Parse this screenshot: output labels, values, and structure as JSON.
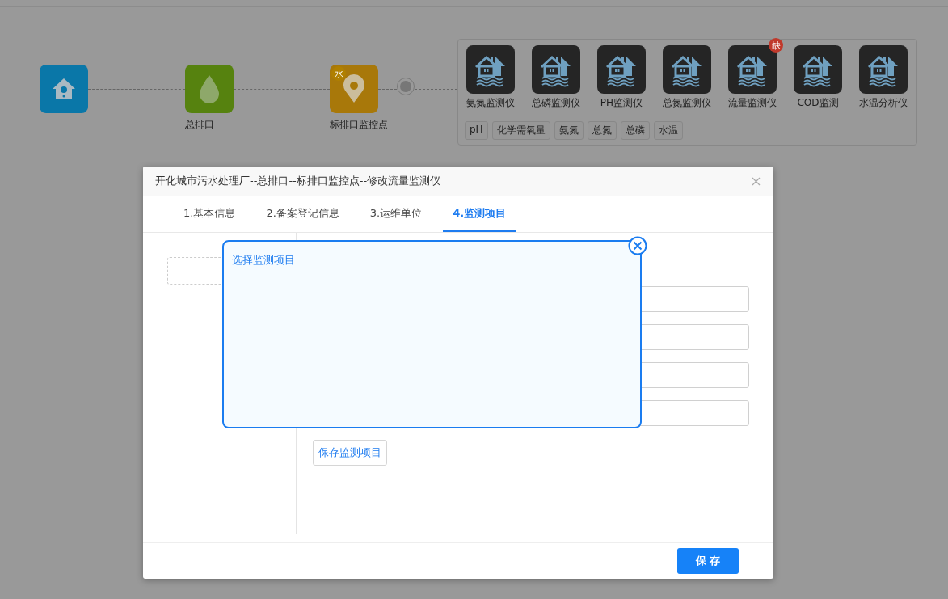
{
  "flow": {
    "nodes": [
      {
        "kind": "home",
        "color": "#0a77a8"
      },
      {
        "kind": "drop",
        "color": "#56820f",
        "label": "总排口"
      },
      {
        "kind": "pin",
        "color": "#a8780a",
        "label": "标排口监控点",
        "badge": "水"
      },
      {
        "kind": "dot"
      }
    ]
  },
  "instruments": {
    "items": [
      {
        "label": "氨氮监测仪"
      },
      {
        "label": "总磷监测仪"
      },
      {
        "label": "PH监测仪"
      },
      {
        "label": "总氮监测仪"
      },
      {
        "label": "流量监测仪",
        "badge": "缺"
      },
      {
        "label": "COD监测"
      },
      {
        "label": "水温分析仪"
      }
    ],
    "tags": [
      "pH",
      "化学需氧量",
      "氨氮",
      "总氮",
      "总磷",
      "水温"
    ]
  },
  "dialog": {
    "title": "开化城市污水处理厂--总排口--标排口监控点--修改流量监测仪",
    "tabs": [
      {
        "label": "1.基本信息",
        "selected": false
      },
      {
        "label": "2.备案登记信息",
        "selected": false
      },
      {
        "label": "3.运维单位",
        "selected": false
      },
      {
        "label": "4.监测项目",
        "selected": true
      }
    ],
    "form_fields": [
      {
        "kind": "text"
      },
      {
        "kind": "text"
      },
      {
        "kind": "text"
      },
      {
        "kind": "text"
      }
    ],
    "save_items_button": "保存监测项目",
    "save_button": "保 存"
  },
  "popup": {
    "title": "选择监测项目"
  }
}
